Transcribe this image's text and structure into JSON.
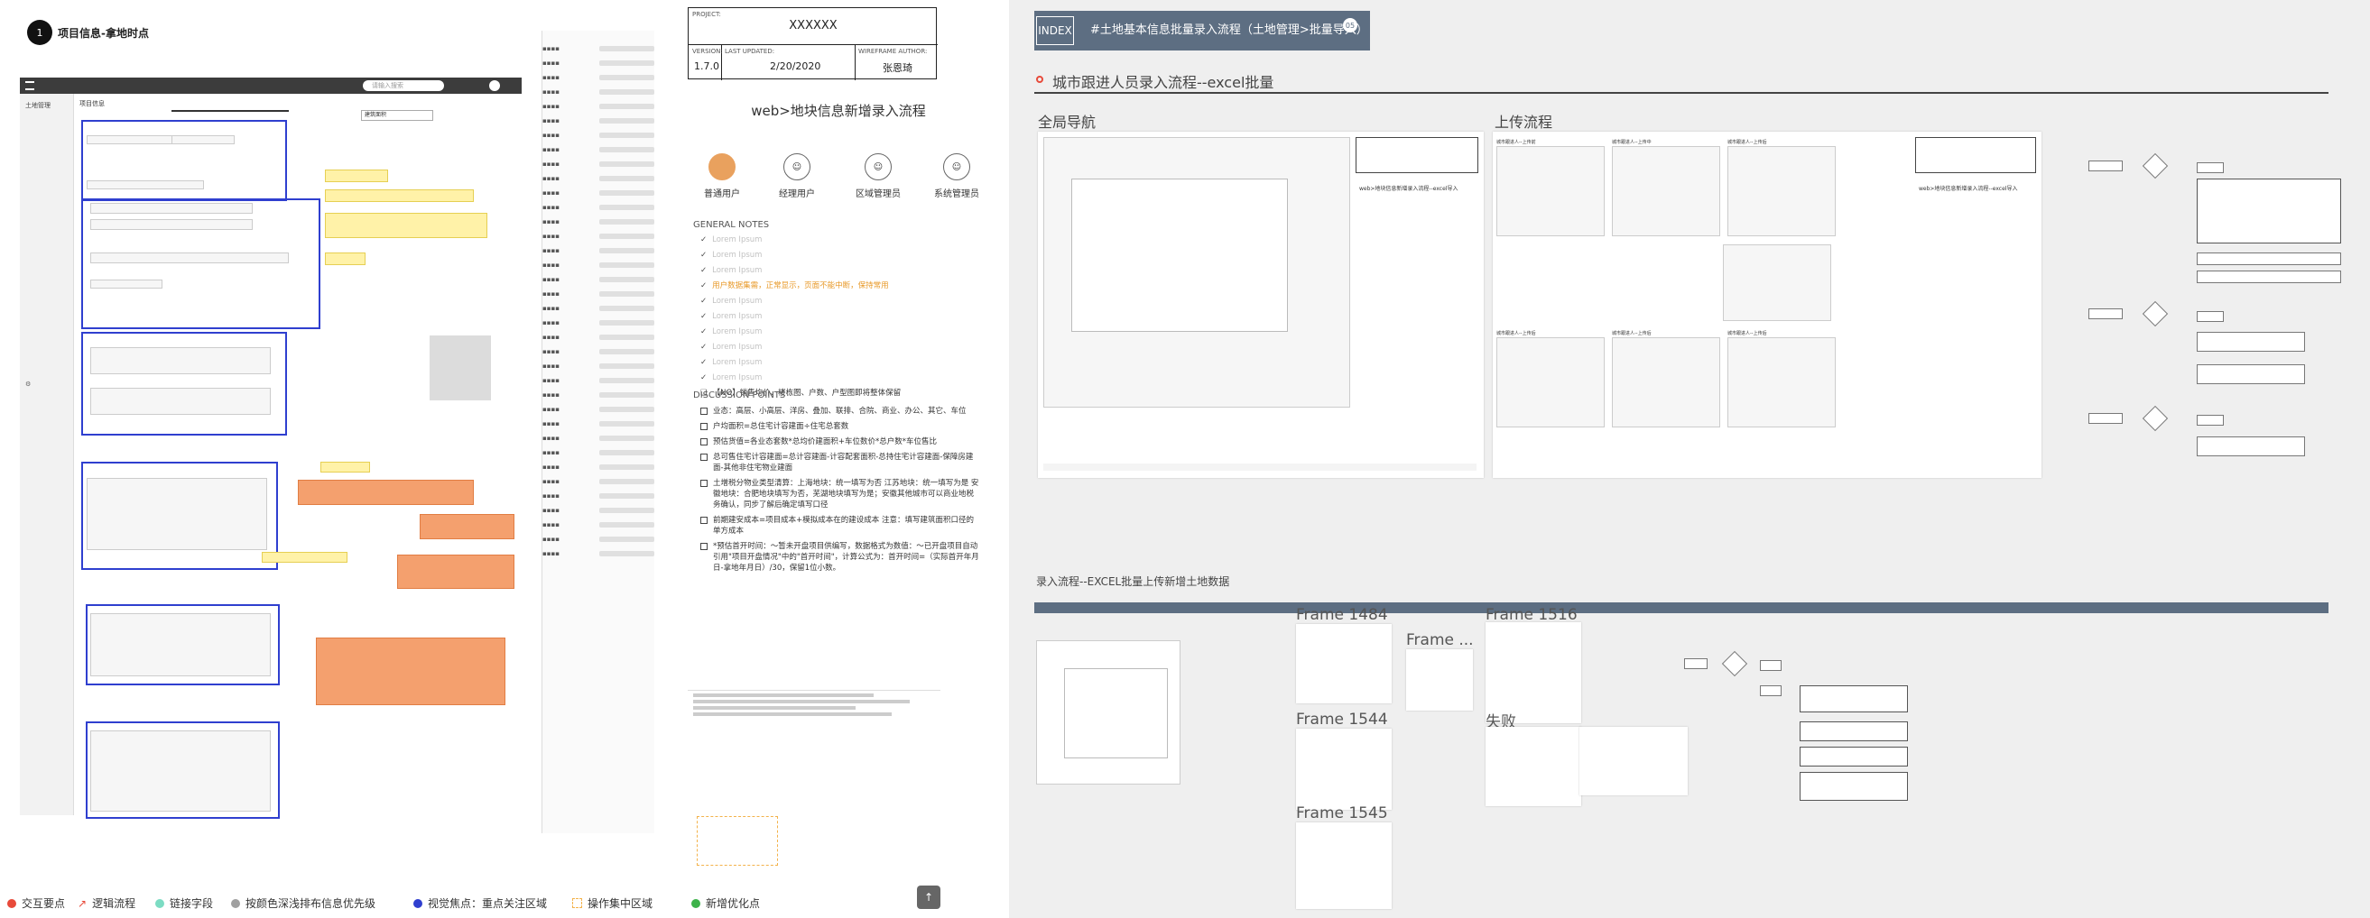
{
  "left": {
    "badge": "1",
    "title": "项目信息-拿地时点",
    "nav_title": "土地管理",
    "tab_active": "项目信息",
    "search_placeholder": "请输入搜索",
    "field_fill": "建筑面积"
  },
  "header_box": {
    "project_label": "PROJECT:",
    "project_value": "XXXXXX",
    "version_label": "VERSION:",
    "version_value": "1.7.0",
    "updated_label": "LAST UPDATED:",
    "updated_value": "2/20/2020",
    "author_label": "WIREFRAME AUTHOR:",
    "author_value": "张恩琦"
  },
  "mid": {
    "page_title": "web>地块信息新增录入流程",
    "roles": [
      "普通用户",
      "经理用户",
      "区域管理员",
      "系统管理员"
    ],
    "general_notes_title": "GENERAL NOTES",
    "general_notes": [
      {
        "text": "Lorem Ipsum",
        "hl": false
      },
      {
        "text": "Lorem Ipsum",
        "hl": false
      },
      {
        "text": "Lorem Ipsum",
        "hl": false
      },
      {
        "text": "用户数据集需，正常显示，页面不能中断，保持常用",
        "hl": true
      },
      {
        "text": "Lorem Ipsum",
        "hl": false
      },
      {
        "text": "Lorem Ipsum",
        "hl": false
      },
      {
        "text": "Lorem Ipsum",
        "hl": false
      },
      {
        "text": "Lorem Ipsum",
        "hl": false
      },
      {
        "text": "Lorem Ipsum",
        "hl": false
      },
      {
        "text": "Lorem Ipsum",
        "hl": false
      },
      {
        "text": "【NO】销售均价、楼栋图、户数、户型图即将整体保留",
        "hl": false
      }
    ],
    "discussion_title": "DISCUSSION POINTS",
    "discussion": [
      "业态：高层、小高层、洋房、叠加、联排、合院、商业、办公、其它、车位",
      "户均面积=总住宅计容建面÷住宅总套数",
      "预估货值=各业态套数*总均价建面积+车位数价*总户数*车位售比",
      "总可售住宅计容建面=总计容建面-计容配套面积-总持住宅计容建面-保障房建面-其他非住宅物业建面",
      "土增税分物业类型清算：上海地块：统一填写为否 江苏地块：统一填写为是 安徽地块：合肥地块填写为否，芜湖地块填写为是；安徽其他城市可以商业地税务确认，同步了解后确定填写口径",
      "前期建安成本=项目成本+模拟成本在的建设成本 注意：填写建筑面积口径的单方成本",
      "*预估首开时间：～暂未开盘项目供编写，数据格式为数值：～已开盘项目自动引用\"项目开盘情况\"中的\"首开时间\"，计算公式为：首开时间=（实际首开年月日-拿地年月日）/30，保留1位小数。"
    ]
  },
  "legend": [
    {
      "label": "交互要点",
      "color": "#e84a3a",
      "icon": "red-number-dot"
    },
    {
      "label": "逻辑流程",
      "color": "#e84a3a",
      "icon": "flow-arrow"
    },
    {
      "label": "链接字段",
      "color": "#7cdcc3",
      "icon": "teal-dot"
    },
    {
      "label": "按颜色深浅排布信息优先级",
      "color": "#a0a0a0",
      "icon": "gray-dot"
    },
    {
      "label": "视觉焦点：重点关注区域",
      "color": "#2f3fcf",
      "icon": "blue-dot"
    },
    {
      "label": "操作集中区域",
      "color": "#f3b24a",
      "icon": "dashed-square"
    },
    {
      "label": "新增优化点",
      "color": "#3db24a",
      "icon": "green-dot"
    }
  ],
  "right": {
    "banner_title": "#土地基本信息批量录入流程（土地管理>批量导入）",
    "banner_badge": "05",
    "banner_sub": "INDEX",
    "section_title": "城市跟进人员录入流程--excel批量",
    "panel1_title": "全局导航",
    "panel2_title": "上传流程",
    "sub_section": "录入流程--EXCEL批量上传新增土地数据",
    "frames": [
      "Frame 1484",
      "Frame 1544",
      "Frame 1545",
      "Frame ...",
      "Frame 1516"
    ],
    "fail_label": "失败",
    "doc_title": "web>地块信息新增录入流程--excel导入",
    "upload_steps": [
      "城市跟进人--上传前",
      "城市跟进人--上传中",
      "城市跟进人--上传后",
      "城市跟进人--上传后",
      "城市跟进人--上传后",
      "城市跟进人--上传后"
    ]
  }
}
